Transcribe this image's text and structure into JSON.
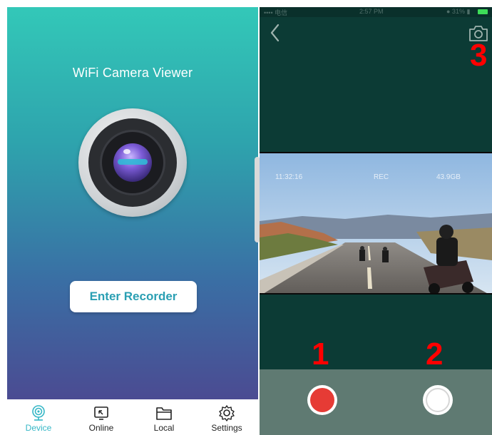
{
  "left": {
    "app_title": "WiFi Camera Viewer",
    "enter_button": "Enter Recorder",
    "tabs": [
      {
        "label": "Device",
        "icon": "device-icon",
        "active": true
      },
      {
        "label": "Online",
        "icon": "online-icon",
        "active": false
      },
      {
        "label": "Local",
        "icon": "folder-icon",
        "active": false
      },
      {
        "label": "Settings",
        "icon": "gear-icon",
        "active": false
      }
    ]
  },
  "right": {
    "statusbar": {
      "left": "•••• 电信",
      "center": "2:57 PM",
      "right": "● 31% ▮"
    },
    "overlay": {
      "time": "11:32:16",
      "rec": "REC",
      "size": "43.9GB"
    },
    "markers": {
      "record": "1",
      "photo": "2",
      "snapshot": "3"
    },
    "back_icon": "chevron-left-icon",
    "snapshot_icon": "camera-icon"
  },
  "colors": {
    "accent": "#35b7c6",
    "record": "#e63b35",
    "marker": "#ff0000",
    "dark_bg": "#0c3b35"
  }
}
